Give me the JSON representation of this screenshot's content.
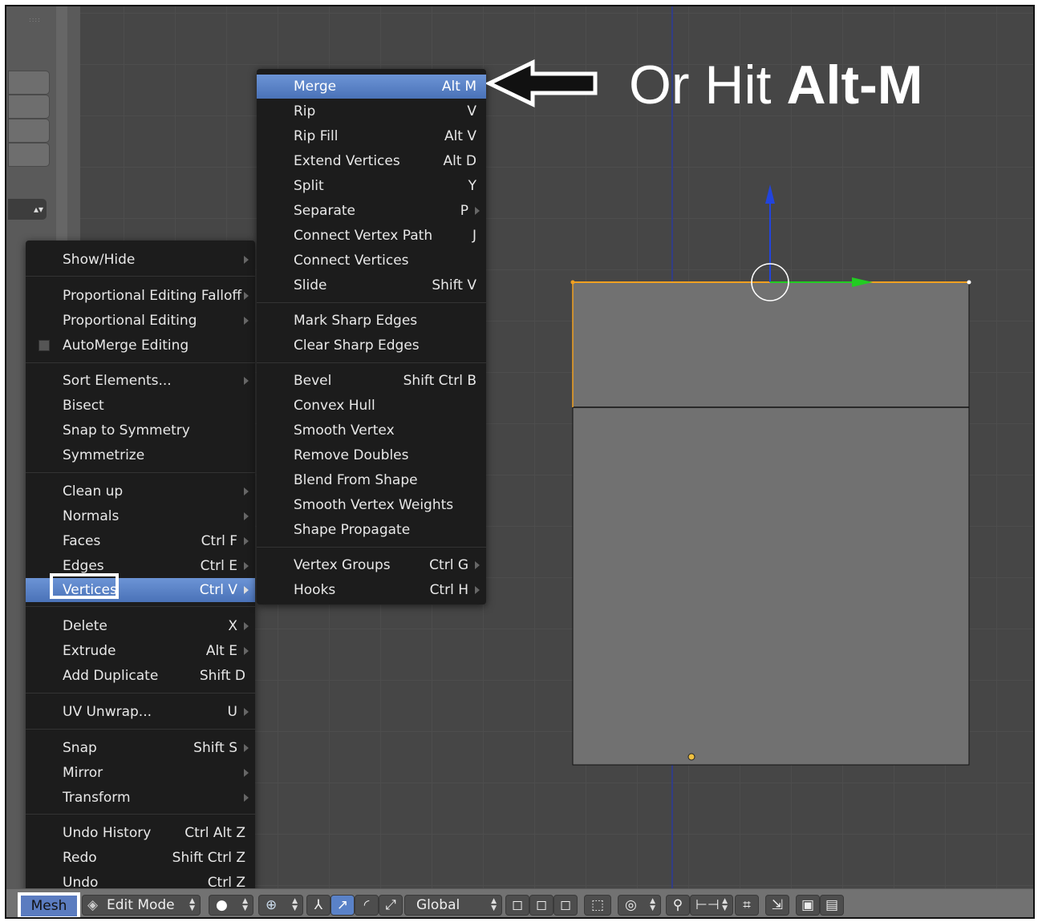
{
  "mesh_menu": {
    "items": [
      {
        "label": "Show/Hide",
        "shortcut": "",
        "submenu": true
      },
      {
        "label": "Proportional Editing Falloff",
        "shortcut": "",
        "submenu": true
      },
      {
        "label": "Proportional Editing",
        "shortcut": "",
        "submenu": true
      },
      {
        "label": "AutoMerge Editing",
        "shortcut": "",
        "submenu": false
      },
      {
        "label": "Sort Elements...",
        "shortcut": "",
        "submenu": true
      },
      {
        "label": "Bisect",
        "shortcut": "",
        "submenu": false
      },
      {
        "label": "Snap to Symmetry",
        "shortcut": "",
        "submenu": false
      },
      {
        "label": "Symmetrize",
        "shortcut": "",
        "submenu": false
      },
      {
        "label": "Clean up",
        "shortcut": "",
        "submenu": true
      },
      {
        "label": "Normals",
        "shortcut": "",
        "submenu": true
      },
      {
        "label": "Faces",
        "shortcut": "Ctrl F",
        "submenu": true
      },
      {
        "label": "Edges",
        "shortcut": "Ctrl E",
        "submenu": true
      },
      {
        "label": "Vertices",
        "shortcut": "Ctrl V",
        "submenu": true
      },
      {
        "label": "Delete",
        "shortcut": "X",
        "submenu": true
      },
      {
        "label": "Extrude",
        "shortcut": "Alt E",
        "submenu": true
      },
      {
        "label": "Add Duplicate",
        "shortcut": "Shift D",
        "submenu": false
      },
      {
        "label": "UV Unwrap...",
        "shortcut": "U",
        "submenu": true
      },
      {
        "label": "Snap",
        "shortcut": "Shift S",
        "submenu": true
      },
      {
        "label": "Mirror",
        "shortcut": "",
        "submenu": true
      },
      {
        "label": "Transform",
        "shortcut": "",
        "submenu": true
      },
      {
        "label": "Undo History",
        "shortcut": "Ctrl Alt Z",
        "submenu": false
      },
      {
        "label": "Redo",
        "shortcut": "Shift Ctrl Z",
        "submenu": false
      },
      {
        "label": "Undo",
        "shortcut": "Ctrl Z",
        "submenu": false
      }
    ]
  },
  "vertices_menu": {
    "items": [
      {
        "label": "Merge",
        "shortcut": "Alt M",
        "submenu": false
      },
      {
        "label": "Rip",
        "shortcut": "V",
        "submenu": false
      },
      {
        "label": "Rip Fill",
        "shortcut": "Alt V",
        "submenu": false
      },
      {
        "label": "Extend Vertices",
        "shortcut": "Alt D",
        "submenu": false
      },
      {
        "label": "Split",
        "shortcut": "Y",
        "submenu": false
      },
      {
        "label": "Separate",
        "shortcut": "P",
        "submenu": true
      },
      {
        "label": "Connect Vertex Path",
        "shortcut": "J",
        "submenu": false
      },
      {
        "label": "Connect Vertices",
        "shortcut": "",
        "submenu": false
      },
      {
        "label": "Slide",
        "shortcut": "Shift V",
        "submenu": false
      },
      {
        "label": "Mark Sharp Edges",
        "shortcut": "",
        "submenu": false
      },
      {
        "label": "Clear Sharp Edges",
        "shortcut": "",
        "submenu": false
      },
      {
        "label": "Bevel",
        "shortcut": "Shift Ctrl B",
        "submenu": false
      },
      {
        "label": "Convex Hull",
        "shortcut": "",
        "submenu": false
      },
      {
        "label": "Smooth Vertex",
        "shortcut": "",
        "submenu": false
      },
      {
        "label": "Remove Doubles",
        "shortcut": "",
        "submenu": false
      },
      {
        "label": "Blend From Shape",
        "shortcut": "",
        "submenu": false
      },
      {
        "label": "Smooth Vertex Weights",
        "shortcut": "",
        "submenu": false
      },
      {
        "label": "Shape Propagate",
        "shortcut": "",
        "submenu": false
      },
      {
        "label": "Vertex Groups",
        "shortcut": "Ctrl G",
        "submenu": true
      },
      {
        "label": "Hooks",
        "shortcut": "Ctrl H",
        "submenu": true
      }
    ]
  },
  "annotation": {
    "prefix": "Or Hit ",
    "bold": "Alt-M"
  },
  "header": {
    "mesh_label": "Mesh",
    "mode_label": "Edit Mode",
    "orientation_label": "Global"
  },
  "colors": {
    "highlight": "#5a82c8",
    "selected_edge": "#f0a020",
    "manipulator_y": "#22cc22",
    "manipulator_z": "#2244dd"
  }
}
